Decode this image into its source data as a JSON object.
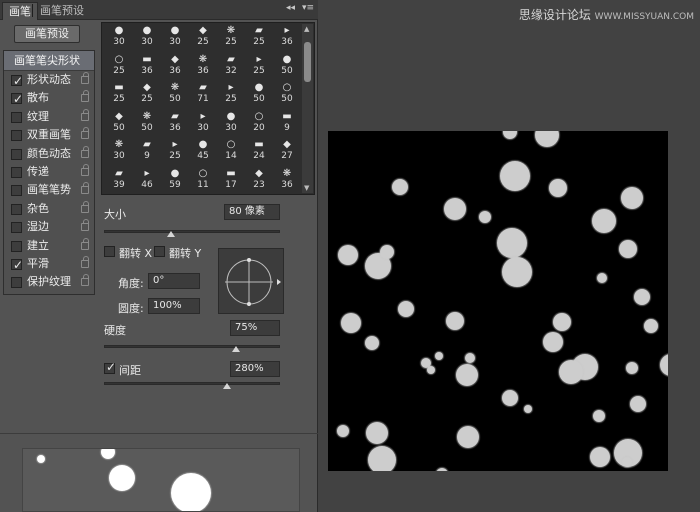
{
  "tabs": [
    {
      "label": "画笔",
      "active": true
    },
    {
      "label": "画笔预设",
      "active": false
    }
  ],
  "tab_controls": {
    "collapse_glyph": "◂◂",
    "menu_glyph": "▾≡"
  },
  "preset_button": "画笔预设",
  "settings": {
    "header": "画笔笔尖形状",
    "items": [
      {
        "label": "形状动态",
        "checked": true
      },
      {
        "label": "散布",
        "checked": true
      },
      {
        "label": "纹理",
        "checked": false
      },
      {
        "label": "双重画笔",
        "checked": false
      },
      {
        "label": "颜色动态",
        "checked": false
      },
      {
        "label": "传递",
        "checked": false
      },
      {
        "label": "画笔笔势",
        "checked": false
      },
      {
        "label": "杂色",
        "checked": false
      },
      {
        "label": "湿边",
        "checked": false
      },
      {
        "label": "建立",
        "checked": false
      },
      {
        "label": "平滑",
        "checked": true
      },
      {
        "label": "保护纹理",
        "checked": false
      }
    ]
  },
  "brush_sizes": [
    [
      "30",
      "30",
      "30",
      "25",
      "25",
      "25",
      "36"
    ],
    [
      "25",
      "36",
      "36",
      "36",
      "32",
      "25",
      "50"
    ],
    [
      "25",
      "25",
      "50",
      "71",
      "25",
      "50",
      "50"
    ],
    [
      "50",
      "50",
      "36",
      "30",
      "30",
      "20",
      "9"
    ],
    [
      "30",
      "9",
      "25",
      "45",
      "14",
      "24",
      "27"
    ],
    [
      "39",
      "46",
      "59",
      "11",
      "17",
      "23",
      "36"
    ]
  ],
  "size": {
    "label": "大小",
    "value": "80 像素",
    "slider_fraction": 0.38
  },
  "flip_x": {
    "label": "翻转 X",
    "checked": false
  },
  "flip_y": {
    "label": "翻转 Y",
    "checked": false
  },
  "angle": {
    "label": "角度:",
    "value": "0°"
  },
  "roundness": {
    "label": "圆度:",
    "value": "100%"
  },
  "hardness": {
    "label": "硬度",
    "value": "75%",
    "slider_fraction": 0.75
  },
  "spacing": {
    "label": "间距",
    "value": "280%",
    "checked": true,
    "slider_fraction": 0.7
  },
  "watermark": {
    "main": "思缘设计论坛",
    "small": "WWW.MISSYUAN.COM"
  },
  "colors": {
    "panel": "#535353",
    "canvas": "#000000",
    "dot": "#cdcdcd",
    "selected_row": "#6a6d74"
  }
}
